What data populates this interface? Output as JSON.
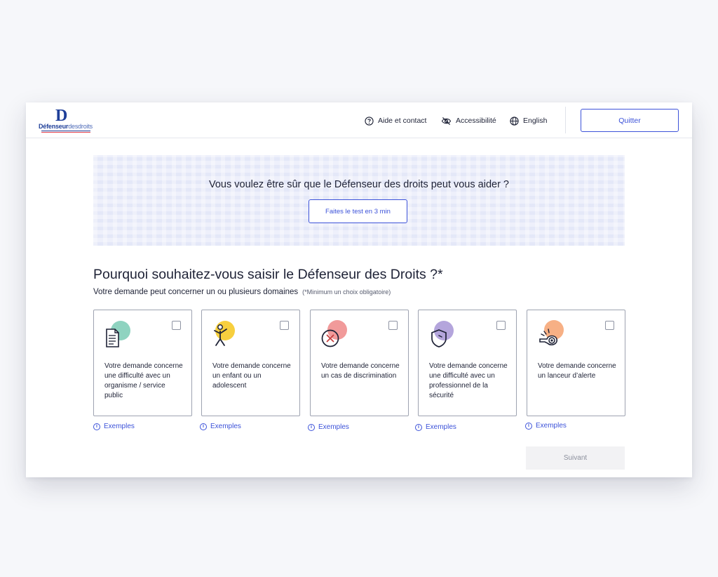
{
  "header": {
    "logo_letter": "D",
    "logo_text_bold": "Défenseur",
    "logo_text_light": "desdroits",
    "nav": {
      "help_label": "Aide et contact",
      "accessibility_label": "Accessibilité",
      "language_label": "English"
    },
    "quit_label": "Quitter"
  },
  "banner": {
    "title": "Vous voulez être sûr que le Défenseur des droits peut vous aider ?",
    "button_label": "Faites le test en 3 min"
  },
  "main": {
    "title": "Pourquoi souhaitez-vous saisir le Défenseur des Droits ?",
    "required_mark": "*",
    "subtitle": "Votre demande peut concerner un ou plusieurs domaines",
    "hint": "(*Minimum un choix obligatoire)",
    "cards": [
      {
        "text": "Votre demande concerne une difficulté avec un organisme / service public",
        "icon": "document-icon",
        "accent": "#8fd3c0"
      },
      {
        "text": "Votre demande concerne un enfant ou un adolescent",
        "icon": "child-icon",
        "accent": "#f7cf3e"
      },
      {
        "text": "Votre demande concerne un cas de discrimination",
        "icon": "discrimination-icon",
        "accent": "#f19a9a"
      },
      {
        "text": "Votre demande concerne une difficulté avec un professionnel de la sécurité",
        "icon": "shield-icon",
        "accent": "#b4a5dc"
      },
      {
        "text": "Votre demande concerne un lanceur d’alerte",
        "icon": "whistle-icon",
        "accent": "#f7b085"
      }
    ],
    "examples_label": "Exemples",
    "next_label": "Suivant"
  },
  "colors": {
    "primary": "#3c52d9",
    "logo_blue": "#1f3f99",
    "banner_bg": "#eef0fb"
  }
}
